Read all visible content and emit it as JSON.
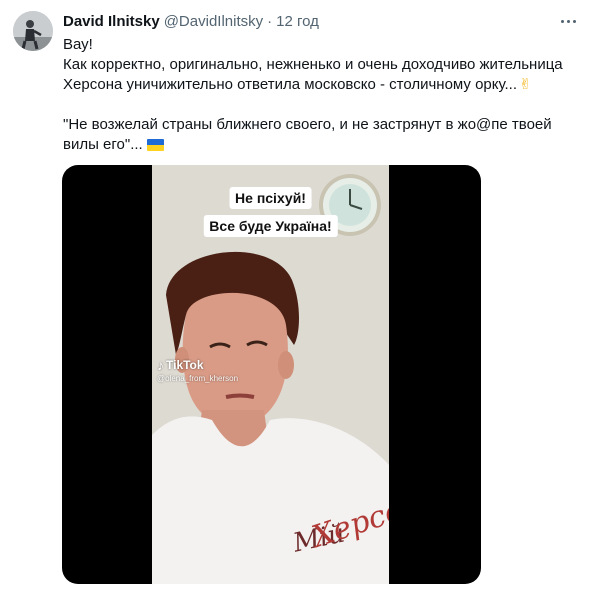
{
  "author": {
    "name": "David Ilnitsky",
    "handle": "@DavidIlnitsky",
    "separator": "·",
    "time": "12 год"
  },
  "tweet": {
    "lines": [
      "Вау!",
      "Как корректно, оригинально, нежненько и очень доходчиво жительница",
      "Херсона уничижительно ответила московско - столичному орку..."
    ],
    "quote_lines": [
      "\"Не возжелай страны ближнего своего, и не застрянут в жо@пе твоей",
      "вилы его\"..."
    ],
    "emoji_1": "victory-hand",
    "emoji_2": "ukraine-flag"
  },
  "video": {
    "caption_1": "Не псіхуй!",
    "caption_2": "Все буде Україна!",
    "watermark": "TikTok",
    "watermark_user": "@olena_from_kherson",
    "shirt_text": "Мій Херсон"
  },
  "colors": {
    "text": "#0f1419",
    "secondary": "#536471",
    "flag_blue": "#1e6bd6",
    "flag_yellow": "#ffd21f"
  }
}
